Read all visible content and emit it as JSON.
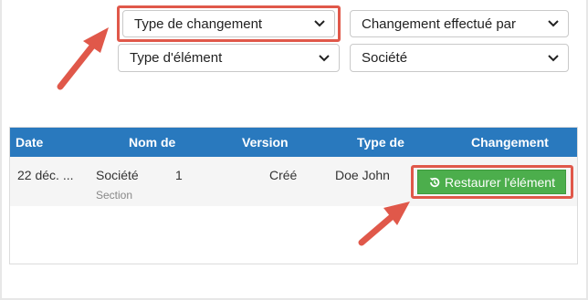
{
  "filters": {
    "change_type": "Type de changement",
    "changed_by": "Changement effectué par",
    "element_type": "Type d'élément",
    "company": "Société"
  },
  "table": {
    "headers": [
      "Date",
      "Nom de",
      "Version",
      "Type de",
      "Changement"
    ],
    "rows": [
      {
        "date": "22 déc. ...",
        "name": "Société",
        "name_sub": "Section",
        "version": "1",
        "type": "Créé",
        "changed_by": "Doe John",
        "action_label": "Restaurer l'élément"
      }
    ]
  },
  "colors": {
    "header_bg": "#2979be",
    "button_bg": "#4cae4c",
    "highlight": "#e0584a"
  },
  "icons": [
    "caret-down-icon",
    "restore-icon",
    "arrow-icon"
  ]
}
